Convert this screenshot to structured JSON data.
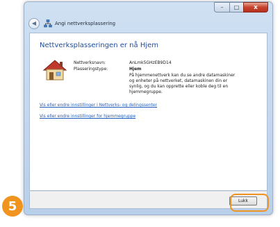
{
  "window": {
    "title": "Angi nettverksplassering",
    "caption": {
      "minimize": "–",
      "maximize": "□",
      "close": "x"
    }
  },
  "main": {
    "heading": "Nettverksplasseringen er nå Hjem",
    "network_name_label": "Nettverksnavn:",
    "network_name_value": "AnLmk5GHzEB9D14",
    "location_type_label": "Plasseringstype:",
    "location_type_value": "Hjem",
    "description": "På hjemmenettverk kan du se andre datamaskiner og enheter på nettverket, datamaskinen din er synlig, og du kan opprette eller koble deg til en hjemmegruppe.",
    "links": [
      "Vis eller endre innstillinger i Nettverks- og delingssenter",
      "Vis eller endre innstillinger for hjemmegruppe"
    ]
  },
  "footer": {
    "close_label": "Lukk"
  },
  "annotation": {
    "step": "5",
    "accent_color": "#f0941f"
  },
  "icons": {
    "back": "back-arrow-icon",
    "network": "network-icon",
    "house": "home-icon"
  }
}
